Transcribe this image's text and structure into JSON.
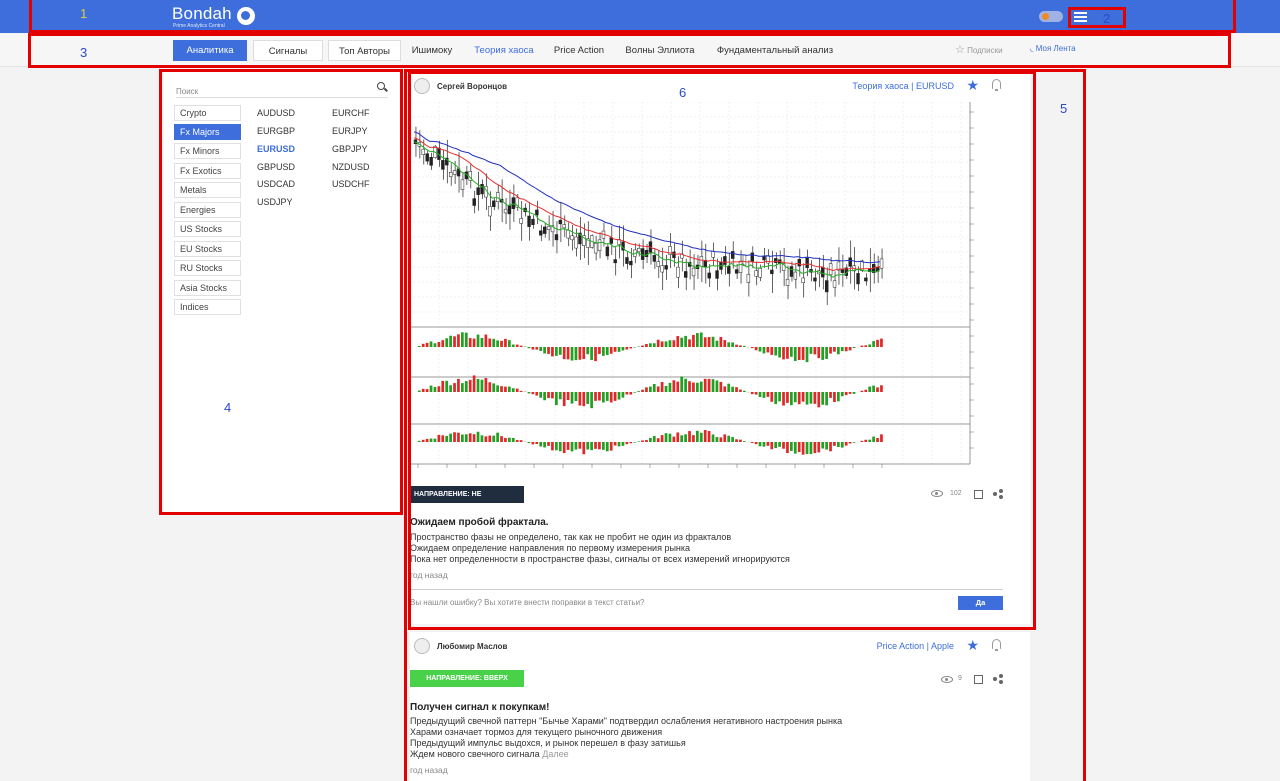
{
  "header": {
    "logo": "Bondah",
    "logo_subtitle": "Prime Analytics Central",
    "icons": [
      "globe-icon",
      "theme-toggle",
      "menu-icon"
    ]
  },
  "nav": {
    "items": [
      "Аналитика",
      "Сигналы",
      "Топ Авторы",
      "Ишимоку",
      "Теория хаоса",
      "Price Action",
      "Волны Эллиота",
      "Фундаментальный анализ"
    ],
    "subscriptions": "Подписки",
    "my_feed": "Моя Лента"
  },
  "sidebar": {
    "search_placeholder": "Поиск",
    "categories": [
      "Crypto",
      "Fx Majors",
      "Fx Minors",
      "Fx Exotics",
      "Metals",
      "Energies",
      "US Stocks",
      "EU Stocks",
      "RU Stocks",
      "Asia Stocks",
      "Indices"
    ],
    "active_category": "Fx Majors",
    "pairs_col1": [
      "AUDUSD",
      "EURGBP",
      "EURUSD",
      "GBPUSD",
      "USDCAD",
      "USDJPY"
    ],
    "pairs_col2": [
      "EURCHF",
      "EURJPY",
      "GBPJPY",
      "NZDUSD",
      "USDCHF"
    ],
    "active_pair": "EURUSD"
  },
  "posts": [
    {
      "author": "Сергей Воронцов",
      "tags": "Теория хаоса | EURUSD",
      "direction": "НАПРАВЛЕНИЕ: НЕ ОПРЕДЕЛЕНО",
      "views": "102",
      "headline": "Ожидаем пробой фрактала.",
      "body": [
        "Пространство фазы не определено, так как не пробит не один из фракталов",
        "Ожидаем определение направления по первому измерения рынка",
        "Пока нет определенности в пространстве фазы, сигналы от всех измерений игнорируются"
      ],
      "ago": "год назад",
      "feedback": "Вы нашли ошибку? Вы хотите внести поправки в текст статьи?",
      "feedback_button": "Да",
      "direction_color": "#1f2d3f"
    },
    {
      "author": "Любомир Маслов",
      "tags": "Price Action | Apple",
      "direction": "НАПРАВЛЕНИЕ: ВВЕРХ",
      "views": "9",
      "headline": "Получен сигнал к покупкам!",
      "body": [
        "Предыдущий свечной паттерн \"Бычье Харами\" подтвердил ослабления негативного настроения рынка",
        "Харами означает тормоз для текущего рыночного движения",
        "Предыдущий импульс выдохся, и рынок перешел в фазу затишья",
        "Ждем нового свечного сигнала"
      ],
      "more": "Далее",
      "ago": "год назад",
      "direction_color": "#4ad14a"
    }
  ],
  "annotations": [
    "1",
    "2",
    "3",
    "4",
    "5",
    "6"
  ],
  "colors": {
    "accent": "#3d6edb",
    "frame": "#e20000",
    "label": "#2d49c9"
  }
}
